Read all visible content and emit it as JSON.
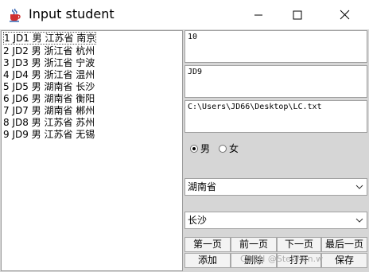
{
  "window": {
    "title": "Input student",
    "icon": "java-cup-icon",
    "controls": [
      "minimize-icon",
      "maximize-icon",
      "close-icon"
    ]
  },
  "student_list": {
    "items": [
      "1 JD1 男 江苏省 南京",
      "2 JD2 男 浙江省 杭州",
      "3 JD3 男 浙江省 宁波",
      "4 JD4 男 浙江省 温州",
      "5 JD5 男 湖南省 长沙",
      "6 JD6 男 湖南省 衡阳",
      "7 JD7 男 湖南省 郴州",
      "8 JD8 男 江苏省 苏州",
      "9 JD9 男 江苏省 无锡"
    ],
    "selected_index": 0
  },
  "form": {
    "number_value": "10",
    "name_value": "JD9",
    "file_path": "C:\\Users\\JD66\\Desktop\\LC.txt",
    "gender": {
      "male_label": "男",
      "female_label": "女",
      "selected": "male"
    },
    "province_value": "湖南省",
    "city_value": "长沙"
  },
  "buttons": {
    "first_page": "第一页",
    "prev_page": "前一页",
    "next_page": "下一页",
    "last_page": "最后一页",
    "add": "添加",
    "delete": "删除",
    "open": "打开",
    "save": "保存"
  },
  "watermark": "CSDN @Stephen.w",
  "colors": {
    "frame_bg": "#d6d6d6",
    "button_bg": "#f3f3f3"
  }
}
